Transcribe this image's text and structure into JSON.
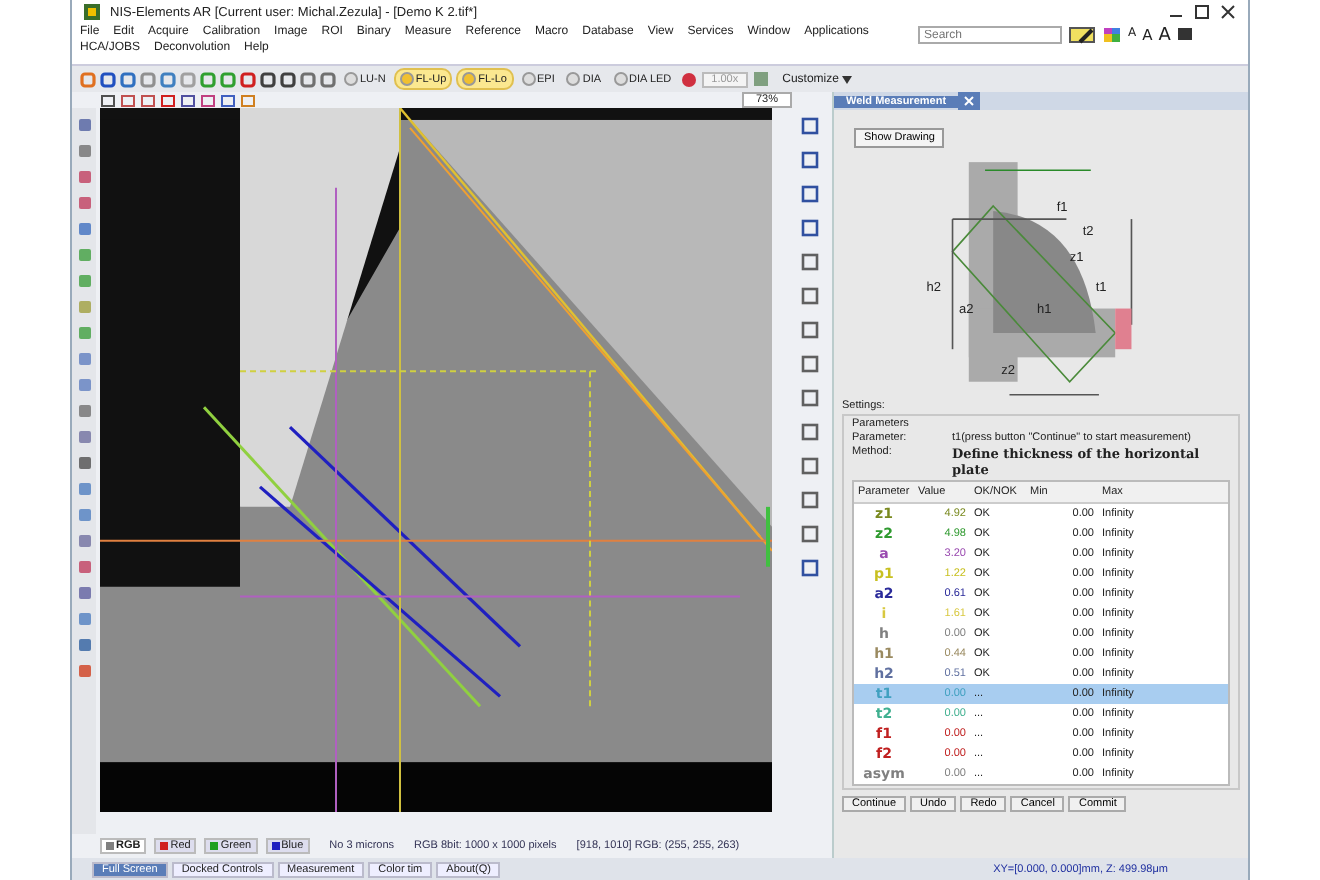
{
  "window": {
    "title": "NIS-Elements AR [Current user: Michal.Zezula] - [Demo K 2.tif*]"
  },
  "menu": [
    "File",
    "Edit",
    "Acquire",
    "Calibration",
    "Image",
    "ROI",
    "Binary",
    "Measure",
    "Reference",
    "Macro",
    "Database",
    "View",
    "Services",
    "Window",
    "Applications",
    "HCA/JOBS",
    "Deconvolution",
    "Help"
  ],
  "search": {
    "placeholder": "Search"
  },
  "font_buttons": [
    "A",
    "A",
    "A"
  ],
  "lamps": [
    {
      "label": "LU-N",
      "selected": false
    },
    {
      "label": "FL-Up",
      "selected": true
    },
    {
      "label": "FL-Lo",
      "selected": true
    },
    {
      "label": "EPI",
      "selected": false
    },
    {
      "label": "DIA",
      "selected": false
    },
    {
      "label": "DIA LED",
      "selected": false
    }
  ],
  "magnification": "1.00x",
  "customize": "Customize",
  "zoom": "73%",
  "panel": {
    "title": "Weld Measurement",
    "show_drawing": "Show Drawing",
    "diagram_labels": [
      "t2",
      "z1",
      "h2",
      "z2",
      "a2",
      "h1",
      "t1",
      "f1"
    ],
    "settings": "Settings:",
    "group": "Parameters",
    "parameter_label": "Parameter:",
    "parameter_value": "t1(press button \"Continue\" to start measurement)",
    "method_label": "Method:",
    "method_value": "Define thickness of the horizontal plate",
    "columns": [
      "Parameter",
      "Value",
      "OK/NOK",
      "Min",
      "Max"
    ],
    "rows": [
      {
        "name": "z1",
        "value": "4.92",
        "status": "OK",
        "min": "0.00",
        "max": "Infinity",
        "color": "#7a8a20",
        "selected": false
      },
      {
        "name": "z2",
        "value": "4.98",
        "status": "OK",
        "min": "0.00",
        "max": "Infinity",
        "color": "#2f9a2f",
        "selected": false
      },
      {
        "name": "a",
        "value": "3.20",
        "status": "OK",
        "min": "0.00",
        "max": "Infinity",
        "color": "#9a4ab0",
        "selected": false
      },
      {
        "name": "p1",
        "value": "1.22",
        "status": "OK",
        "min": "0.00",
        "max": "Infinity",
        "color": "#c8c020",
        "selected": false
      },
      {
        "name": "a2",
        "value": "0.61",
        "status": "OK",
        "min": "0.00",
        "max": "Infinity",
        "color": "#2a2a9a",
        "selected": false
      },
      {
        "name": "i",
        "value": "1.61",
        "status": "OK",
        "min": "0.00",
        "max": "Infinity",
        "color": "#d8c840",
        "selected": false
      },
      {
        "name": "h",
        "value": "0.00",
        "status": "OK",
        "min": "0.00",
        "max": "Infinity",
        "color": "#808080",
        "selected": false
      },
      {
        "name": "h1",
        "value": "0.44",
        "status": "OK",
        "min": "0.00",
        "max": "Infinity",
        "color": "#9a8a60",
        "selected": false
      },
      {
        "name": "h2",
        "value": "0.51",
        "status": "OK",
        "min": "0.00",
        "max": "Infinity",
        "color": "#6070a0",
        "selected": false
      },
      {
        "name": "t1",
        "value": "0.00",
        "status": "...",
        "min": "0.00",
        "max": "Infinity",
        "color": "#40a0c0",
        "selected": true
      },
      {
        "name": "t2",
        "value": "0.00",
        "status": "...",
        "min": "0.00",
        "max": "Infinity",
        "color": "#40b090",
        "selected": false
      },
      {
        "name": "f1",
        "value": "0.00",
        "status": "...",
        "min": "0.00",
        "max": "Infinity",
        "color": "#c02020",
        "selected": false
      },
      {
        "name": "f2",
        "value": "0.00",
        "status": "...",
        "min": "0.00",
        "max": "Infinity",
        "color": "#c02020",
        "selected": false
      },
      {
        "name": "asym",
        "value": "0.00",
        "status": "...",
        "min": "0.00",
        "max": "Infinity",
        "color": "#808080",
        "selected": false
      }
    ],
    "buttons": [
      "Continue",
      "Undo",
      "Redo",
      "Cancel",
      "Commit"
    ]
  },
  "channels": [
    {
      "label": "RGB",
      "color": "#808080",
      "selected": true
    },
    {
      "label": "Red",
      "color": "#d02020",
      "selected": false
    },
    {
      "label": "Green",
      "color": "#20a020",
      "selected": false
    },
    {
      "label": "Blue",
      "color": "#2020c0",
      "selected": false
    }
  ],
  "image_info": [
    "No 3 microns",
    "RGB 8bit: 1000 x 1000 pixels",
    "[918, 1010] RGB: (255, 255, 263)"
  ],
  "bottom_tabs": [
    {
      "label": "Full Screen",
      "selected": true
    },
    {
      "label": "Docked Controls",
      "selected": false
    },
    {
      "label": "Measurement",
      "selected": false
    },
    {
      "label": "Color tim",
      "selected": false
    },
    {
      "label": "About(Q)",
      "selected": false
    }
  ],
  "status": "XY=[0.000, 0.000]mm, Z: 499.98μm"
}
